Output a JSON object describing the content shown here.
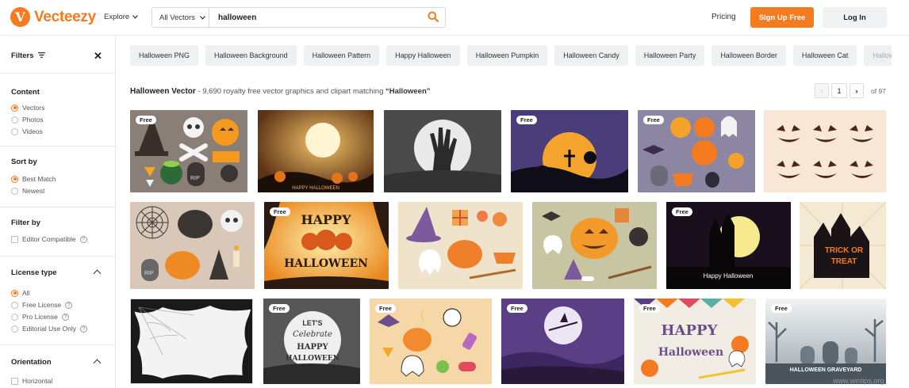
{
  "header": {
    "brand": "Vecteezy",
    "logo_mark": "V",
    "explore_label": "Explore",
    "search_category": "All Vectors",
    "search_value": "halloween",
    "pricing_label": "Pricing",
    "signup_label": "Sign Up Free",
    "login_label": "Log In",
    "accent": "#f47b20"
  },
  "sidebar": {
    "filters_label": "Filters",
    "sections": {
      "content": {
        "title": "Content",
        "options": [
          "Vectors",
          "Photos",
          "Videos"
        ],
        "selected": "Vectors"
      },
      "sort": {
        "title": "Sort by",
        "options": [
          "Best Match",
          "Newest"
        ],
        "selected": "Best Match"
      },
      "filter": {
        "title": "Filter by",
        "options": [
          "Editor Compatible"
        ]
      },
      "license": {
        "title": "License type",
        "options": [
          "All",
          "Free License",
          "Pro License",
          "Editorial Use Only"
        ],
        "selected": "All"
      },
      "orientation": {
        "title": "Orientation",
        "options": [
          "Horizontal"
        ]
      }
    }
  },
  "chips": [
    "Halloween PNG",
    "Halloween Background",
    "Halloween Pattern",
    "Happy Halloween",
    "Halloween Pumpkin",
    "Halloween Candy",
    "Halloween Party",
    "Halloween Border",
    "Halloween Cat",
    "Halloween Coo"
  ],
  "results": {
    "title": "Halloween Vector",
    "count_text": " - 9,690 royalty free vector graphics and clipart matching ",
    "query": "“Halloween”"
  },
  "pagination": {
    "prev": "‹",
    "current": "1",
    "next": "›",
    "total": "of 97"
  },
  "badge_label": "Free",
  "tile_text": {
    "t2": "HAPPY HALLOWEEN",
    "t14": "Happy Halloween",
    "t15a": "TRICK OR",
    "t15b": "TREAT",
    "t17a": "LET'S",
    "t17b": "Celebrate",
    "t17c": "HAPPY",
    "t17d": "HALLOWEEN",
    "t21a": "HAPPY",
    "t21b": "Halloween",
    "t22": "HALLOWEEN GRAVEYARD",
    "t9a": "HAPPY",
    "t9b": "HALLOWEEN",
    "rip": "RIP"
  },
  "watermark": "www.wintips.org"
}
